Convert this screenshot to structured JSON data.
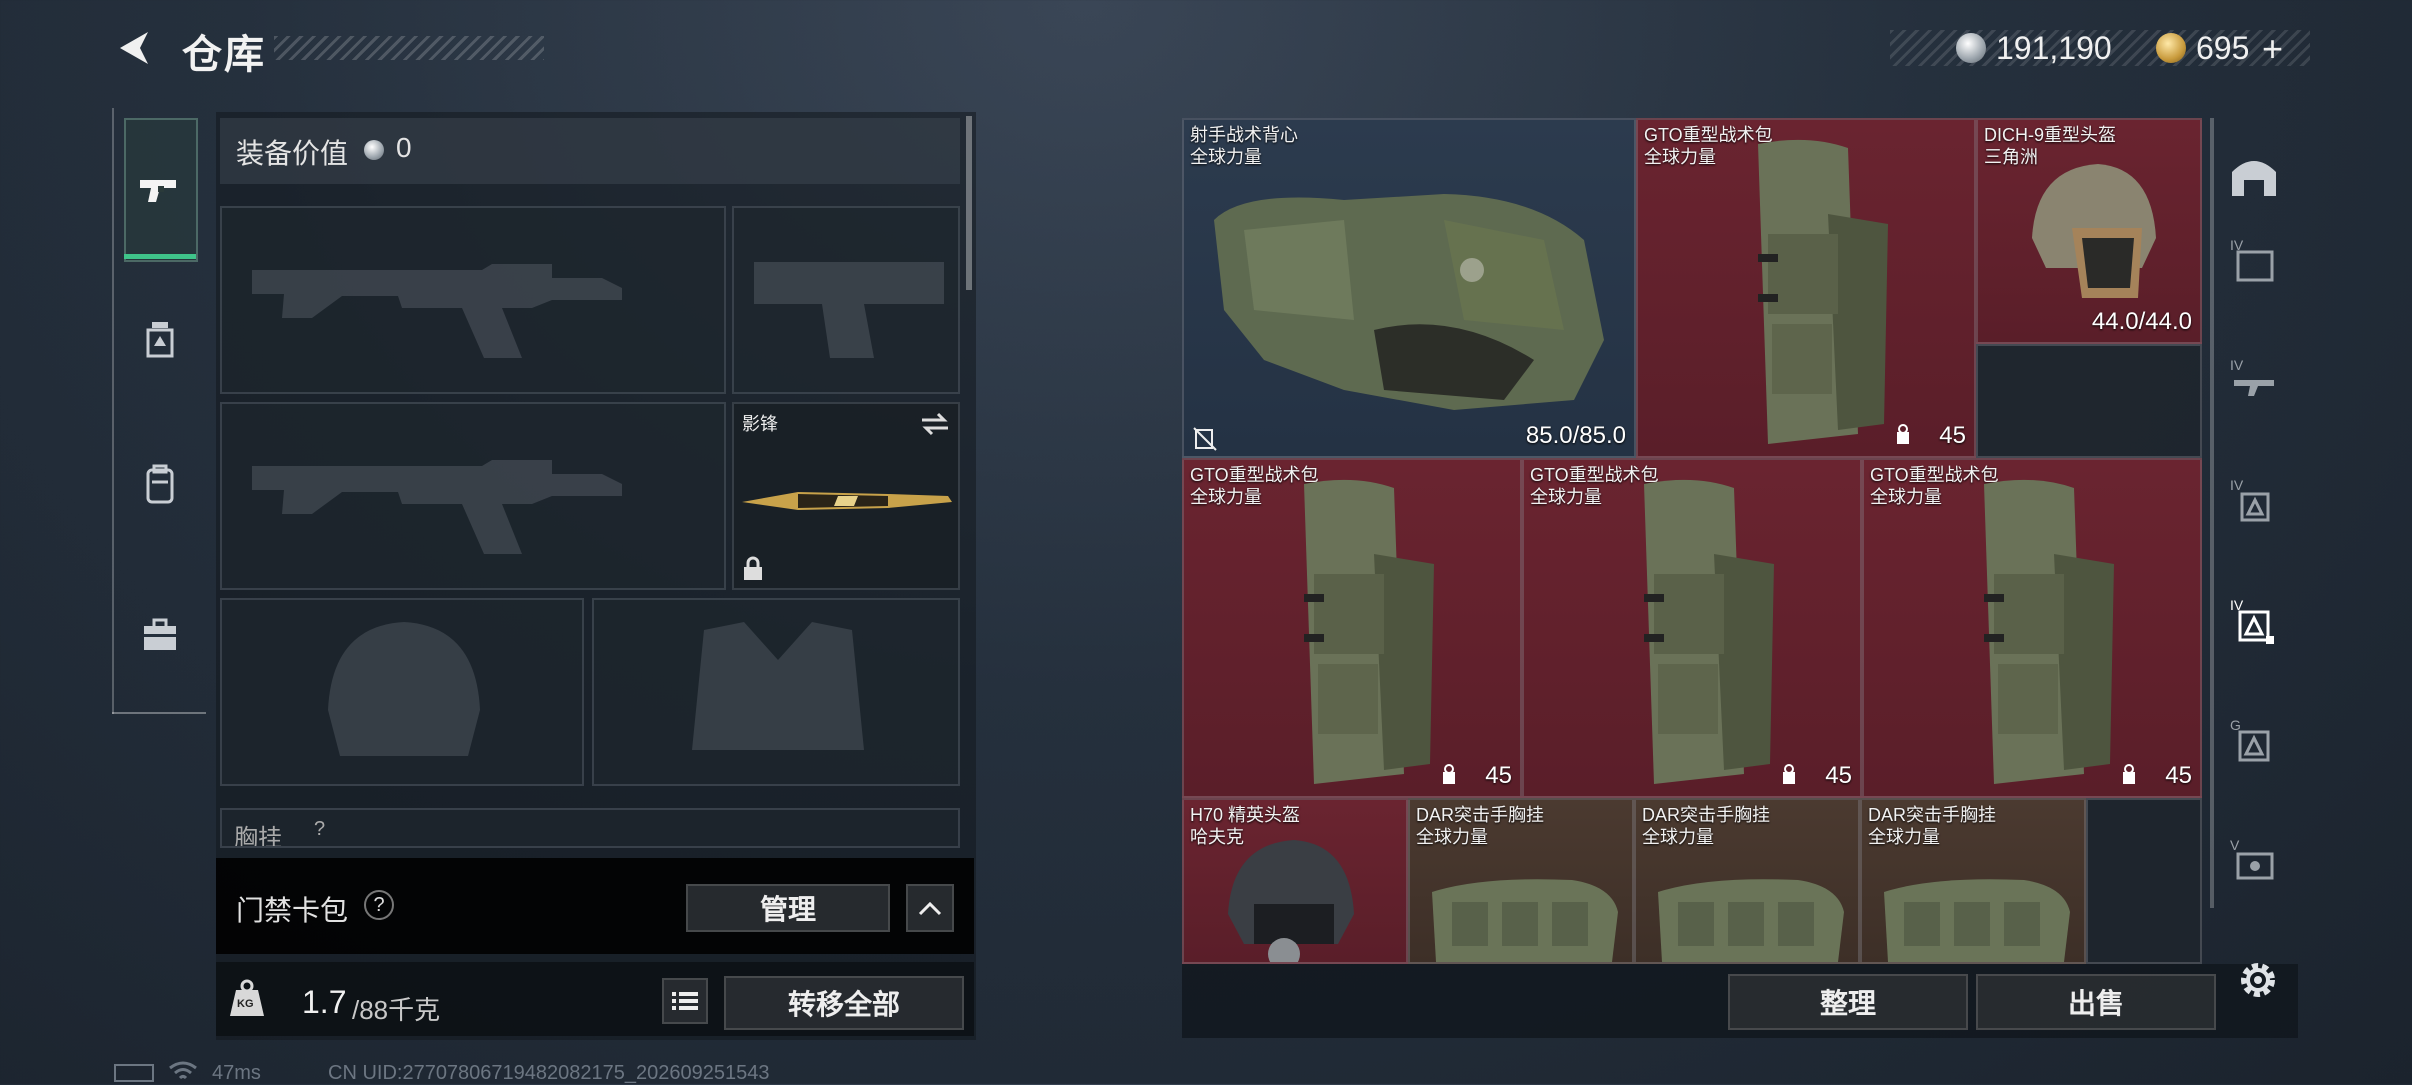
{
  "header": {
    "title": "仓库",
    "silver_amount": "191,190",
    "gold_amount": "695",
    "gold_plus": "+"
  },
  "nav": {
    "items": [
      {
        "icon": "pistol-icon",
        "active": true
      },
      {
        "icon": "grenade-icon",
        "active": false
      },
      {
        "icon": "backpack-icon",
        "active": false
      },
      {
        "icon": "toolbox-icon",
        "active": false
      }
    ]
  },
  "loadout": {
    "equipment_value_label": "装备价值",
    "equipment_value": "0",
    "melee_label": "影锋",
    "chest_rig_label": "胸挂",
    "chest_rig_help": "?",
    "card_pack_label": "门禁卡包",
    "card_pack_help": "?",
    "manage_label": "管理",
    "weight_current": "1.7",
    "weight_max": "/88千克",
    "weight_icon_text": "KG",
    "transfer_all_label": "转移全部"
  },
  "stash": {
    "items": [
      {
        "name": "射手战术背心",
        "sub": "全球力量",
        "value": "85.0/85.0"
      },
      {
        "name": "GTO重型战术包",
        "sub": "全球力量",
        "value": "45"
      },
      {
        "name": "DICH-9重型头盔",
        "sub": "三角洲",
        "value": "44.0/44.0"
      },
      {
        "name": "GTO重型战术包",
        "sub": "全球力量",
        "value": "45"
      },
      {
        "name": "GTO重型战术包",
        "sub": "全球力量",
        "value": "45"
      },
      {
        "name": "GTO重型战术包",
        "sub": "全球力量",
        "value": "45"
      },
      {
        "name": "H70 精英头盔",
        "sub": "哈夫克",
        "value": ""
      },
      {
        "name": "DAR突击手胸挂",
        "sub": "全球力量",
        "value": ""
      },
      {
        "name": "DAR突击手胸挂",
        "sub": "全球力量",
        "value": ""
      },
      {
        "name": "DAR突击手胸挂",
        "sub": "全球力量",
        "value": ""
      }
    ],
    "organize_label": "整理",
    "sell_label": "出售"
  },
  "rail": {
    "tiers": [
      "IV",
      "IV",
      "IV",
      "IV",
      "G",
      "V"
    ]
  },
  "status": {
    "ping": "47ms",
    "uid": "CN UID:27707806719482082175_202609251543"
  },
  "colors": {
    "accent_green": "#3fc48a",
    "red_rarity": "#6a2430",
    "blue_rarity": "#2c3b4e",
    "brown_rarity": "#4b3a30"
  }
}
